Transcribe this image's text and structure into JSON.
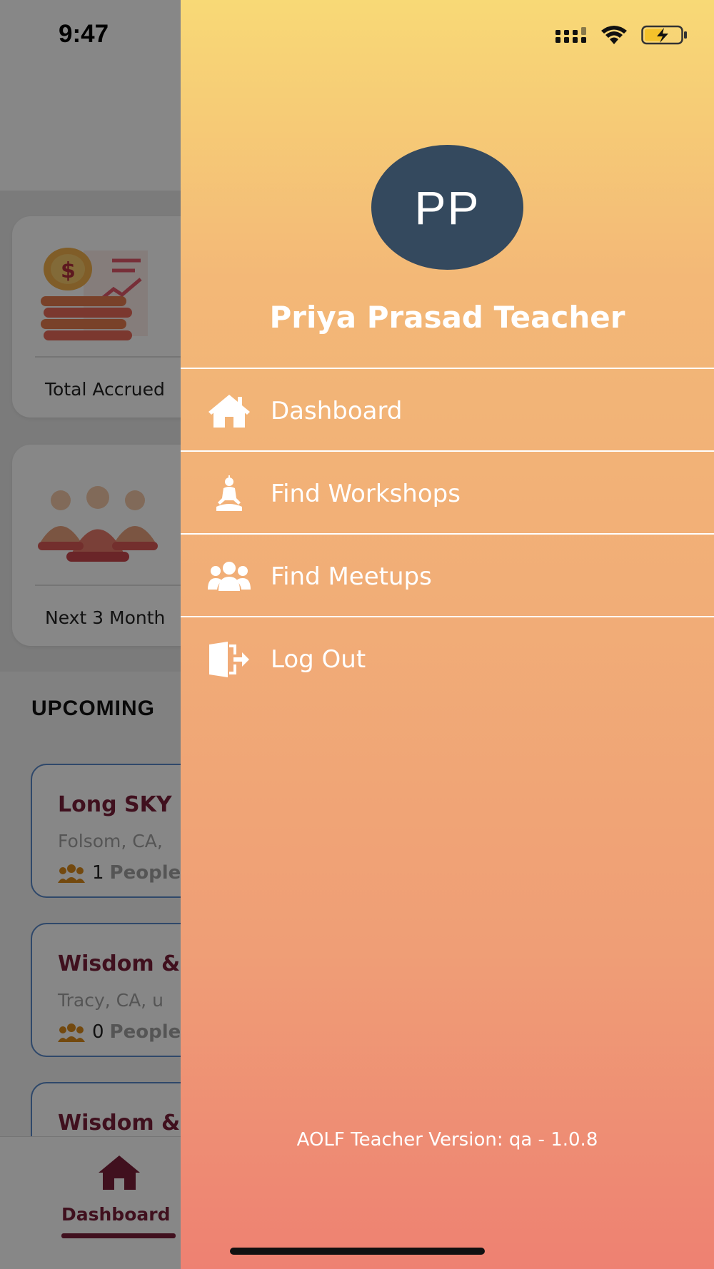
{
  "status_bar": {
    "time": "9:47"
  },
  "background": {
    "stats": [
      {
        "label": "Total Accrued"
      },
      {
        "label": "Next 3 Month"
      }
    ],
    "upcoming_title": "UPCOMING",
    "events": [
      {
        "title": "Long SKY",
        "location": "Folsom, CA,",
        "count": "1",
        "people_label": "People"
      },
      {
        "title": "Wisdom &",
        "location": "Tracy, CA, u",
        "count": "0",
        "people_label": "People"
      },
      {
        "title": "Wisdom &"
      }
    ],
    "bottom_tab": {
      "label": "Dashboard"
    }
  },
  "drawer": {
    "avatar_initials": "PP",
    "user_name": "Priya Prasad Teacher",
    "menu": [
      {
        "label": "Dashboard",
        "icon": "home-icon"
      },
      {
        "label": "Find Workshops",
        "icon": "meditation-icon"
      },
      {
        "label": "Find Meetups",
        "icon": "group-icon"
      },
      {
        "label": "Log Out",
        "icon": "logout-icon"
      }
    ],
    "version": "AOLF Teacher Version: qa - 1.0.8"
  },
  "colors": {
    "drawer_top": "#f8d976",
    "drawer_bottom": "#ee8172",
    "avatar_bg": "#34495e",
    "accent": "#7a1f3a"
  }
}
